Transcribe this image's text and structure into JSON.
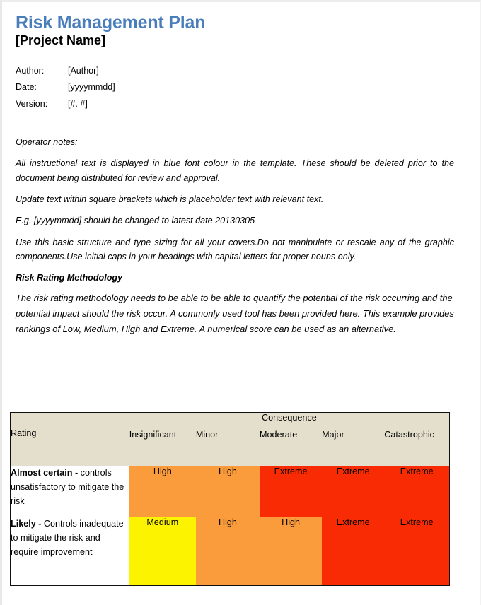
{
  "document": {
    "title": "Risk Management Plan",
    "subtitle": "[Project Name]",
    "title_color": "#4a7ebb"
  },
  "meta": {
    "rows": [
      {
        "label": "Author:",
        "value": "[Author]"
      },
      {
        "label": "Date:",
        "value": "[yyyymmdd]"
      },
      {
        "label": "Version:",
        "value": "[#. #]"
      }
    ]
  },
  "operator_notes": {
    "heading": "Operator notes:",
    "notes": [
      "All instructional text is displayed in blue font colour in the template. These should be deleted prior to the document being distributed for review and approval.",
      "Update text within square brackets which is placeholder text with relevant text.",
      "E.g. [yyyymmdd] should be changed to latest date 20130305",
      "Use this basic structure and type sizing for all your covers.Do not manipulate or rescale any of the graphic components.Use initial caps in your headings with capital letters for proper nouns only."
    ]
  },
  "methodology": {
    "heading": "Risk Rating Methodology",
    "body": "The risk rating methodology needs to be able to be able to quantify the potential of the risk occurring and the potential impact should the risk occur.  A commonly used tool has been provided here.  This example provides rankings of Low, Medium, High and Extreme.  A numerical score can be used as an alternative."
  },
  "matrix": {
    "consequence_header": "Consequence",
    "rating_header": "Rating",
    "consequence_levels": [
      "Insignificant",
      "Minor",
      "Moderate",
      "Major",
      "Catastrophic"
    ],
    "rows": [
      {
        "rating_bold": "Almost certain -",
        "rating_text": " controls unsatisfactory to mitigate the risk",
        "cells": [
          "High",
          "High",
          "Extreme",
          "Extreme",
          "Extreme"
        ]
      },
      {
        "rating_bold": "Likely -",
        "rating_text": " Controls inadequate to mitigate the risk and require improvement",
        "cells": [
          "Medium",
          "High",
          "High",
          "Extreme",
          "Extreme"
        ]
      }
    ],
    "colors": {
      "header_bg": "#e4dfcc",
      "high": "#fa9b3c",
      "extreme": "#f92b05",
      "medium": "#fcf300",
      "low": "#ffffff"
    }
  }
}
